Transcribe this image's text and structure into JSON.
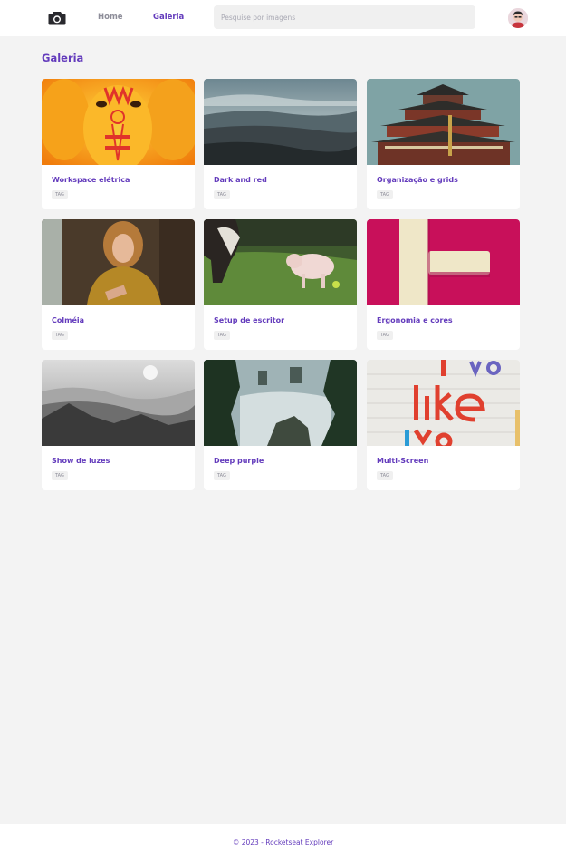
{
  "header": {
    "logo_icon": "camera-icon",
    "nav": {
      "home_label": "Home",
      "gallery_label": "Galeria"
    },
    "search_placeholder": "Pesquise por imagens",
    "avatar_icon": "user-avatar"
  },
  "main": {
    "title": "Galeria",
    "cards": [
      {
        "title": "Workspace elétrica",
        "tag": "TAG",
        "image": "yellow-ganesha-statue"
      },
      {
        "title": "Dark and red",
        "tag": "TAG",
        "image": "mountain-landscape"
      },
      {
        "title": "Organização e grids",
        "tag": "TAG",
        "image": "chinese-pagoda"
      },
      {
        "title": "Colméia",
        "tag": "TAG",
        "image": "woman-yellow-sweater"
      },
      {
        "title": "Setup de escritor",
        "tag": "TAG",
        "image": "dog-and-pig"
      },
      {
        "title": "Ergonomia e cores",
        "tag": "TAG",
        "image": "magenta-letter-wall"
      },
      {
        "title": "Show de luzes",
        "tag": "TAG",
        "image": "misty-mountains-bw"
      },
      {
        "title": "Deep purple",
        "tag": "TAG",
        "image": "coastal-forest"
      },
      {
        "title": "Multi-Screen",
        "tag": "TAG",
        "image": "i-like-you-graffiti"
      }
    ]
  },
  "footer": {
    "text": "© 2023 - Rocketseat Explorer"
  },
  "colors": {
    "accent": "#633bbc",
    "muted": "#8d8d99",
    "background": "#f3f3f3"
  }
}
